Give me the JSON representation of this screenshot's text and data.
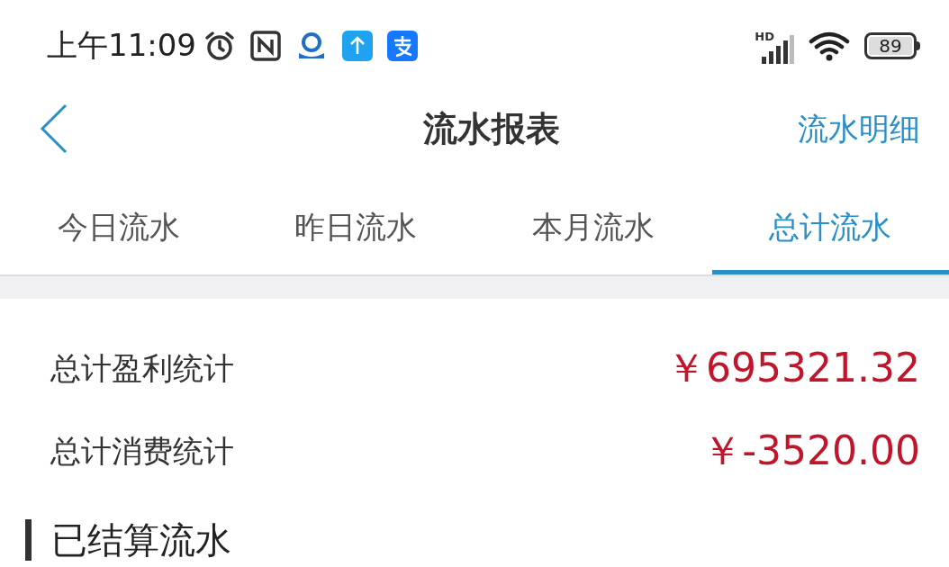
{
  "status_bar": {
    "time": "上午11:09",
    "network": "HD",
    "battery": "89"
  },
  "nav": {
    "title": "流水报表",
    "action": "流水明细"
  },
  "tabs": [
    {
      "label": "今日流水",
      "selected": false
    },
    {
      "label": "昨日流水",
      "selected": false
    },
    {
      "label": "本月流水",
      "selected": false
    },
    {
      "label": "总计流水",
      "selected": true
    }
  ],
  "stats": [
    {
      "label": "总计盈利统计",
      "value": "￥695321.32"
    },
    {
      "label": "总计消费统计",
      "value": "￥-3520.00"
    }
  ],
  "section": {
    "title": "已结算流水"
  }
}
